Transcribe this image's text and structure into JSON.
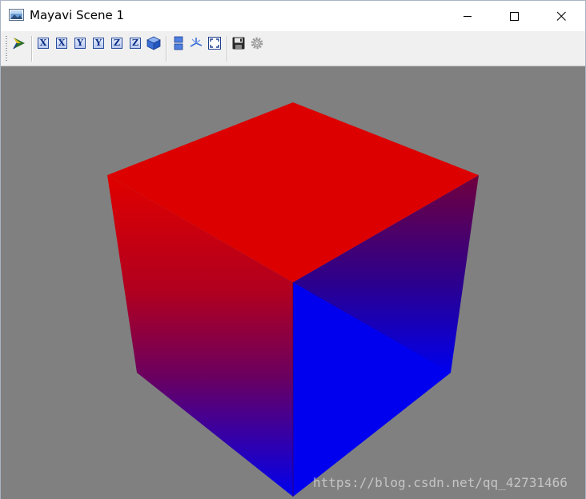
{
  "window": {
    "title": "Mayavi Scene 1",
    "icon": "scene-image-icon",
    "controls": {
      "minimize_icon": "minimize-icon",
      "maximize_icon": "maximize-icon",
      "close_icon": "close-icon"
    }
  },
  "toolbar": {
    "buttons": [
      {
        "name": "mayavi-pipeline-icon"
      },
      {
        "name": "view-x-positive",
        "label": "X"
      },
      {
        "name": "view-x-negative",
        "label": "X"
      },
      {
        "name": "view-y-positive",
        "label": "Y"
      },
      {
        "name": "view-y-negative",
        "label": "Y"
      },
      {
        "name": "view-z-positive",
        "label": "Z"
      },
      {
        "name": "view-z-negative",
        "label": "Z"
      },
      {
        "name": "isometric-view-icon"
      },
      {
        "name": "parallel-projection-icon"
      },
      {
        "name": "toggle-axes-icon"
      },
      {
        "name": "full-screen-icon"
      },
      {
        "name": "save-icon"
      },
      {
        "name": "settings-icon"
      }
    ]
  },
  "scene": {
    "background_color": "#808080",
    "cube": {
      "top_color": "#dd0000",
      "bottom_color": "#0000ee"
    },
    "watermark": "https://blog.csdn.net/qq_42731466"
  }
}
